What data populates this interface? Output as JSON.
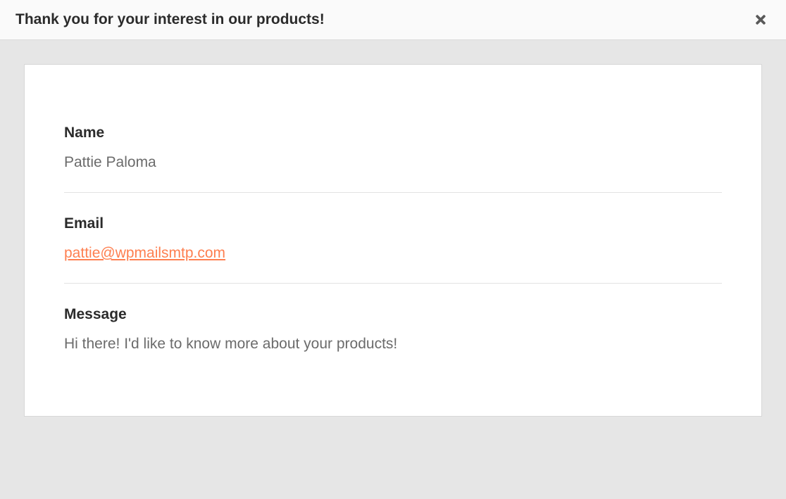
{
  "header": {
    "title": "Thank you for your interest in our products!"
  },
  "fields": {
    "name": {
      "label": "Name",
      "value": "Pattie Paloma"
    },
    "email": {
      "label": "Email",
      "value": "pattie@wpmailsmtp.com"
    },
    "message": {
      "label": "Message",
      "value": "Hi there! I'd like to know more about your products!"
    }
  }
}
